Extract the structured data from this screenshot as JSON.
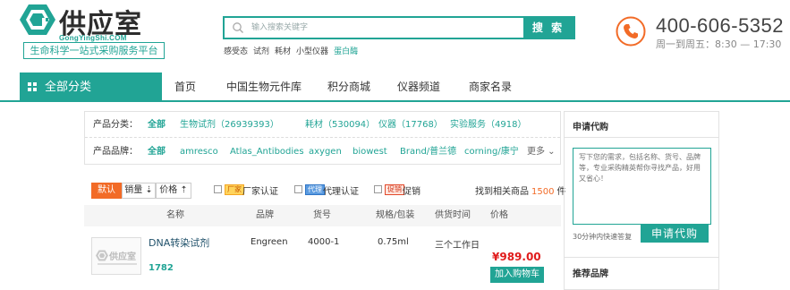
{
  "header": {
    "logo_name": "供应室",
    "logo_domain": "GongYingShi.COM",
    "slogan": "生命科学一站式采购服务平台",
    "search_placeholder": "输入搜索关键字",
    "search_button": "搜 索",
    "hot_words": [
      "感受态",
      "试剂",
      "耗材",
      "小型仪器",
      "蛋白酶"
    ],
    "phone": "400-606-5352",
    "hours": "周一到周五：8:30 — 17:30"
  },
  "nav": {
    "all_categories": "全部分类",
    "items": [
      "首页",
      "中国生物元件库",
      "积分商城",
      "仪器频道",
      "商家名录"
    ]
  },
  "filter": {
    "category_key": "产品分类：",
    "categories": [
      "全部",
      "生物试剂（26939393）",
      "耗材（530094）",
      "仪器（17768）",
      "实验服务（4918）"
    ],
    "brand_key": "产品品牌：",
    "brands": [
      "全部",
      "amresco",
      "Atlas_Antibodies",
      "axygen",
      "biowest",
      "Brand/普兰德",
      "corning/康宁"
    ],
    "more": "更多 ⌄"
  },
  "sortbar": {
    "default": "默认",
    "sales": "销量 ⇣",
    "price": "价格 ⇡",
    "filters": [
      {
        "tag": "厂家",
        "label": "厂家认证"
      },
      {
        "tag": "代理",
        "label": "代理认证"
      },
      {
        "tag": "促销",
        "label": "促销"
      }
    ],
    "found_prefix": "找到相关商品",
    "found_count": "1500",
    "found_suffix": "件"
  },
  "table": {
    "headers": [
      "名称",
      "品牌",
      "货号",
      "规格/包装",
      "供货时间",
      "价格"
    ],
    "rows": [
      {
        "thumb_text": "供应室",
        "name": "DNA转染试剂",
        "count": "1782",
        "brand": "Engreen",
        "sku": "4000-1",
        "spec": "0.75ml",
        "lead_time": "三个工作日",
        "price": "¥989.00",
        "cart": "加入购物车"
      }
    ]
  },
  "side": {
    "title": "申请代购",
    "placeholder": "写下您的需求，包括名称、货号、品牌等，专业采购精英帮你寻找产品，好用又省心！",
    "note": "30分钟内快速答复",
    "button": "申请代购",
    "title2": "推荐品牌"
  },
  "colors": {
    "accent": "#21a495",
    "orange": "#f26b27",
    "price_red": "#e01b1b"
  }
}
